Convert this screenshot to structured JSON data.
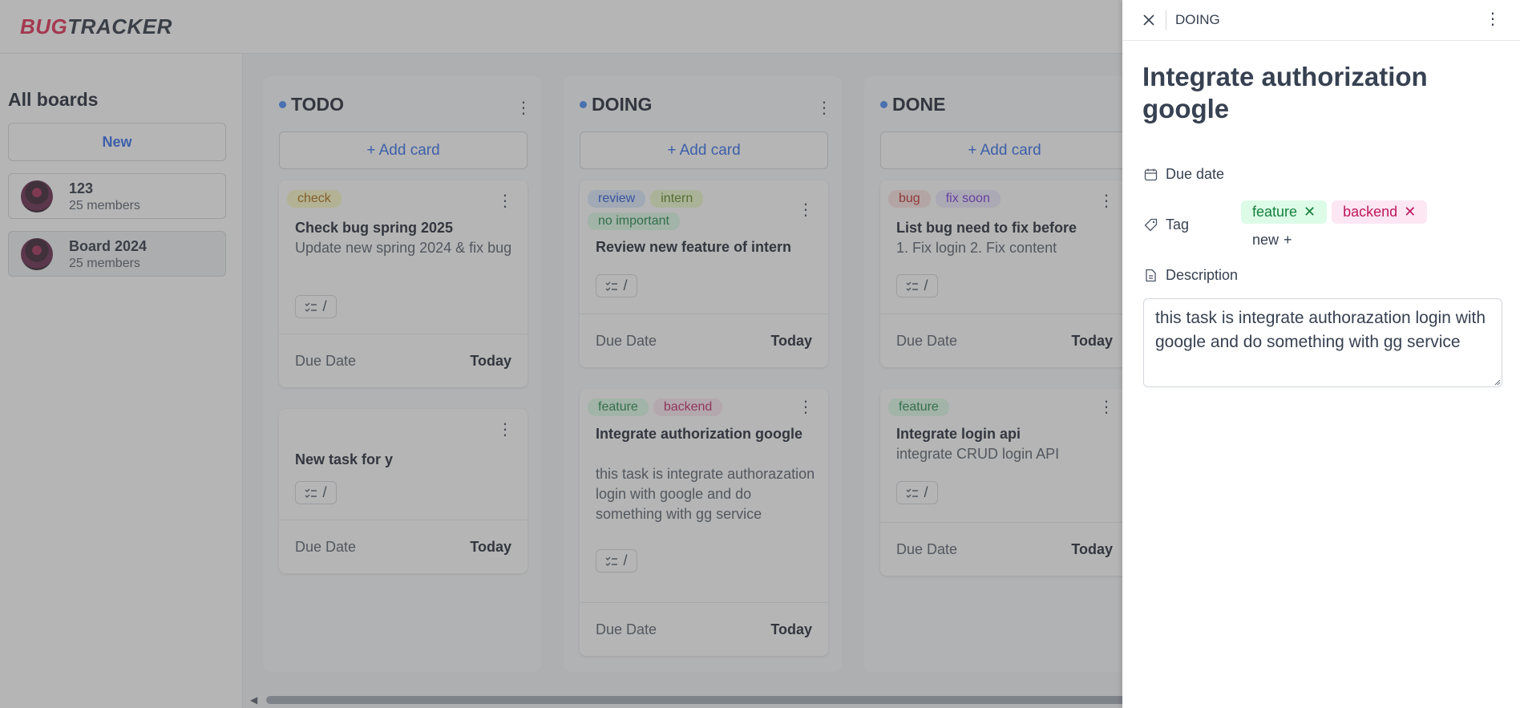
{
  "app": {
    "logo_part1": "BUG",
    "logo_part2": "TRACKER"
  },
  "sidebar": {
    "title": "All boards",
    "new_label": "New",
    "boards": [
      {
        "name": "123",
        "members": "25 members"
      },
      {
        "name": "Board 2024",
        "members": "25 members"
      }
    ]
  },
  "columns": [
    {
      "name": "TODO",
      "add_label": "+ Add card",
      "cards": [
        {
          "tags": [
            {
              "label": "check",
              "color": "yellow"
            }
          ],
          "title": "Check bug spring 2025",
          "desc": "Update new spring 2024 & fix bug",
          "checklist": "/",
          "due_label": "Due Date",
          "due_value": "Today"
        },
        {
          "tags": [],
          "title": "New task for y",
          "desc": "",
          "checklist": "/",
          "due_label": "Due Date",
          "due_value": "Today"
        }
      ]
    },
    {
      "name": "DOING",
      "add_label": "+ Add card",
      "cards": [
        {
          "tags": [
            {
              "label": "review",
              "color": "blue"
            },
            {
              "label": "intern",
              "color": "olive"
            },
            {
              "label": "no important",
              "color": "green"
            }
          ],
          "title": "Review new feature of intern",
          "desc": "",
          "checklist": "/",
          "due_label": "Due Date",
          "due_value": "Today"
        },
        {
          "tags": [
            {
              "label": "feature",
              "color": "green"
            },
            {
              "label": "backend",
              "color": "pink"
            }
          ],
          "title": "Integrate authorization google",
          "desc": "this task is integrate authorazation login with google and do something with gg service",
          "checklist": "/",
          "due_label": "Due Date",
          "due_value": "Today"
        }
      ]
    },
    {
      "name": "DONE",
      "add_label": "+ Add card",
      "cards": [
        {
          "tags": [
            {
              "label": "bug",
              "color": "red"
            },
            {
              "label": "fix soon",
              "color": "purple"
            }
          ],
          "title": "List bug need to fix before",
          "desc": "1. Fix login 2. Fix content",
          "checklist": "/",
          "due_label": "Due Date",
          "due_value": "Today"
        },
        {
          "tags": [
            {
              "label": "feature",
              "color": "green"
            }
          ],
          "title": "Integrate login api",
          "desc": "integrate CRUD login API",
          "checklist": "/",
          "due_label": "Due Date",
          "due_value": "Today"
        }
      ]
    }
  ],
  "panel": {
    "status": "DOING",
    "title": "Integrate authorization google",
    "due_date_label": "Due date",
    "tag_label": "Tag",
    "tags": [
      {
        "label": "feature",
        "color": "green"
      },
      {
        "label": "backend",
        "color": "pink"
      }
    ],
    "new_tag_label": "new",
    "description_label": "Description",
    "description": "this task is integrate authorazation login with google and do something with gg service"
  },
  "colors": {
    "accent": "#2563eb",
    "logo_red": "#e11d48",
    "status_dot": "#3b82f6"
  }
}
